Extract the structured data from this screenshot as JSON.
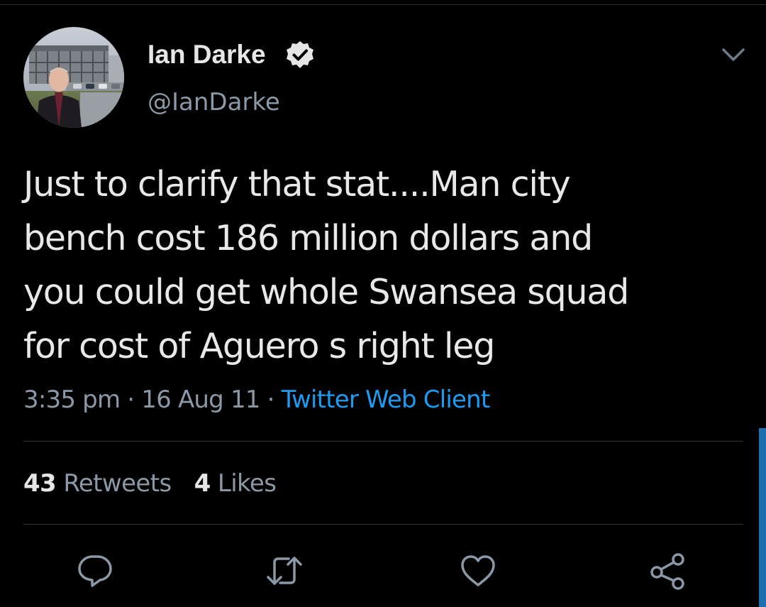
{
  "tweet": {
    "author": {
      "display_name": "Ian Darke",
      "handle": "@IanDarke",
      "verified": true
    },
    "text": "Just to clarify that stat....Man city\nbench cost 186 million dollars and\nyou could get whole Swansea squad\nfor cost of Aguero s right leg",
    "time": "3:35 pm",
    "date": "16 Aug 11",
    "separator": " · ",
    "source": "Twitter Web Client",
    "stats": {
      "retweets_count": "43",
      "retweets_label": "Retweets",
      "likes_count": "4",
      "likes_label": "Likes"
    }
  },
  "icons": {
    "verified": "verified-badge-icon",
    "more": "chevron-down-icon",
    "reply": "reply-icon",
    "retweet": "retweet-icon",
    "like": "heart-icon",
    "share": "share-icon"
  },
  "colors": {
    "background": "#000000",
    "text": "#e8e8e8",
    "secondary": "#8b98a5",
    "link": "#1d9bf0",
    "divider": "#2f3336"
  }
}
